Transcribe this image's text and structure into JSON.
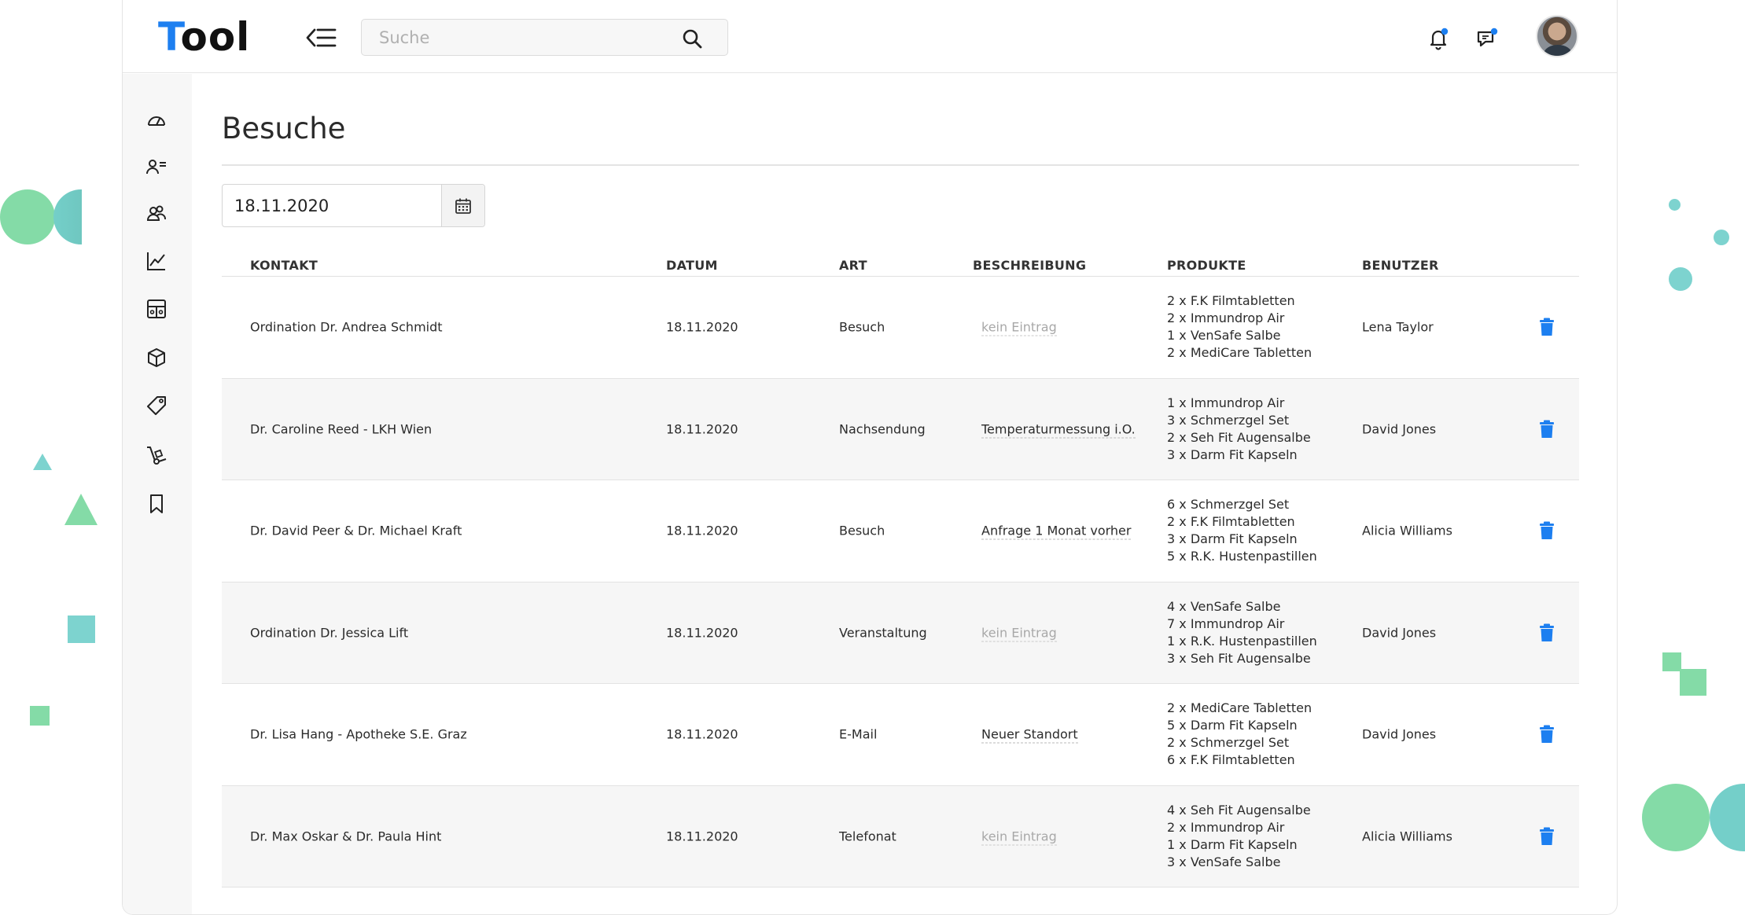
{
  "app": {
    "logo_first": "T",
    "logo_rest": "ool"
  },
  "search": {
    "placeholder": "Suche"
  },
  "page": {
    "title": "Besuche"
  },
  "date_filter": {
    "value": "18.11.2020"
  },
  "colors": {
    "accent": "#1d7ff0",
    "deco_green": "#84dba7",
    "deco_teal": "#74cfc9"
  },
  "sidebar": {
    "items": [
      {
        "icon": "dashboard-gauge-icon"
      },
      {
        "icon": "contact-list-icon"
      },
      {
        "icon": "users-group-icon"
      },
      {
        "icon": "line-chart-icon"
      },
      {
        "icon": "calculator-icon"
      },
      {
        "icon": "box-icon"
      },
      {
        "icon": "tag-icon"
      },
      {
        "icon": "hand-truck-icon"
      },
      {
        "icon": "bookmark-icon"
      }
    ]
  },
  "table": {
    "headers": {
      "kontakt": "KONTAKT",
      "datum": "DATUM",
      "art": "ART",
      "beschreibung": "BESCHREIBUNG",
      "produkte": "PRODUKTE",
      "benutzer": "BENUTZER"
    },
    "rows": [
      {
        "kontakt": "Ordination Dr. Andrea Schmidt",
        "datum": "18.11.2020",
        "art": "Besuch",
        "beschreibung": "kein Eintrag",
        "empty": true,
        "produkte": [
          "2 x F.K Filmtabletten",
          "2 x Immundrop Air",
          "1 x VenSafe Salbe",
          "2 x MediCare Tabletten"
        ],
        "benutzer": "Lena Taylor"
      },
      {
        "kontakt": "Dr. Caroline Reed - LKH Wien",
        "datum": "18.11.2020",
        "art": "Nachsendung",
        "beschreibung": "Temperaturmessung i.O.",
        "empty": false,
        "produkte": [
          "1 x Immundrop Air",
          "3 x Schmerzgel Set",
          "2 x Seh Fit Augensalbe",
          "3 x Darm Fit Kapseln"
        ],
        "benutzer": "David Jones"
      },
      {
        "kontakt": "Dr. David Peer & Dr. Michael Kraft",
        "datum": "18.11.2020",
        "art": "Besuch",
        "beschreibung": "Anfrage 1 Monat vorher",
        "empty": false,
        "produkte": [
          "6 x Schmerzgel Set",
          "2 x F.K Filmtabletten",
          "3 x Darm Fit Kapseln",
          "5 x R.K. Hustenpastillen"
        ],
        "benutzer": "Alicia Williams"
      },
      {
        "kontakt": "Ordination Dr. Jessica Lift",
        "datum": "18.11.2020",
        "art": "Veranstaltung",
        "beschreibung": "kein Eintrag",
        "empty": true,
        "produkte": [
          "4 x VenSafe Salbe",
          "7 x Immundrop Air",
          "1 x R.K. Hustenpastillen",
          "3 x Seh Fit Augensalbe"
        ],
        "benutzer": "David Jones"
      },
      {
        "kontakt": "Dr. Lisa Hang - Apotheke S.E. Graz",
        "datum": "18.11.2020",
        "art": "E-Mail",
        "beschreibung": "Neuer Standort",
        "empty": false,
        "produkte": [
          "2 x MediCare Tabletten",
          "5 x Darm Fit Kapseln",
          "2 x Schmerzgel Set",
          "6 x F.K Filmtabletten"
        ],
        "benutzer": "David Jones"
      },
      {
        "kontakt": "Dr. Max Oskar & Dr. Paula Hint",
        "datum": "18.11.2020",
        "art": "Telefonat",
        "beschreibung": "kein Eintrag",
        "empty": true,
        "produkte": [
          "4 x Seh Fit Augensalbe",
          "2 x Immundrop Air",
          "1 x Darm Fit Kapseln",
          "3 x VenSafe Salbe"
        ],
        "benutzer": "Alicia Williams"
      }
    ]
  }
}
